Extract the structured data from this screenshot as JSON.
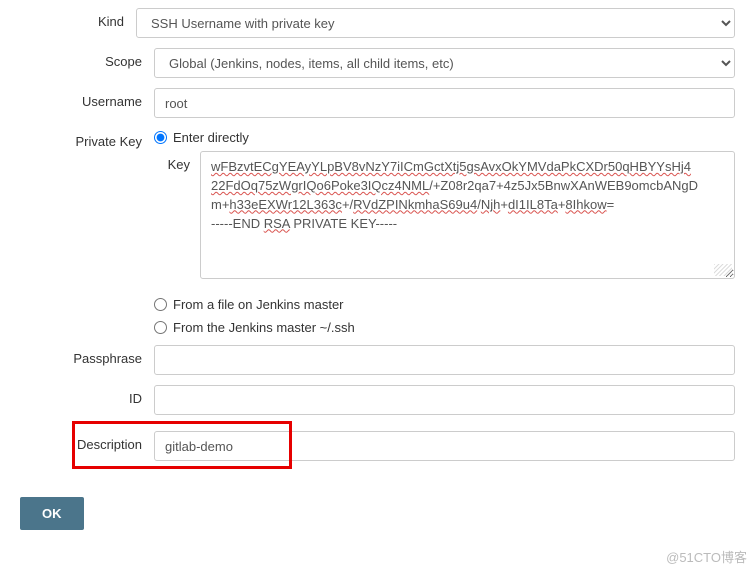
{
  "labels": {
    "kind": "Kind",
    "scope": "Scope",
    "username": "Username",
    "private_key": "Private Key",
    "key": "Key",
    "passphrase": "Passphrase",
    "id": "ID",
    "description": "Description"
  },
  "kind": {
    "selected": "SSH Username with private key"
  },
  "scope": {
    "selected": "Global (Jenkins, nodes, items, all child items, etc)"
  },
  "username": {
    "value": "root"
  },
  "private_key": {
    "options": {
      "enter_directly": "Enter directly",
      "from_file": "From a file on Jenkins master",
      "from_ssh": "From the Jenkins master ~/.ssh"
    },
    "selected": "enter_directly",
    "key_value_lines": [
      {
        "segments": [
          {
            "t": "wFBzvtECgYEAyYLpBV8vNzY7iICmGctXtj5gsAvxOkYMVdaPkCXDr50qHBYYsHj4",
            "s": true
          }
        ]
      },
      {
        "segments": [
          {
            "t": "22FdOq75zWgrIQo6Poke3IQcz4NML",
            "s": true
          },
          {
            "t": "/+Z08r2qa7+4z5Jx5BnwXAnWEB9omcbANgD",
            "s": false
          }
        ]
      },
      {
        "segments": [
          {
            "t": "m+",
            "s": false
          },
          {
            "t": "h33eEXWr12L363c",
            "s": true
          },
          {
            "t": "+/",
            "s": false
          },
          {
            "t": "RVdZPINkmhaS69u4",
            "s": true
          },
          {
            "t": "/",
            "s": false
          },
          {
            "t": "Njh",
            "s": true
          },
          {
            "t": "+",
            "s": false
          },
          {
            "t": "dI1IL8Ta",
            "s": true
          },
          {
            "t": "+",
            "s": false
          },
          {
            "t": "8Ihkow",
            "s": true
          },
          {
            "t": "=",
            "s": false
          }
        ]
      },
      {
        "segments": [
          {
            "t": "-----END ",
            "s": false
          },
          {
            "t": "RSA",
            "s": true
          },
          {
            "t": " PRIVATE KEY-----",
            "s": false
          }
        ]
      }
    ]
  },
  "passphrase": {
    "value": ""
  },
  "id": {
    "value": ""
  },
  "description": {
    "value": "gitlab-demo"
  },
  "buttons": {
    "ok": "OK"
  },
  "watermark": "@51CTO博客"
}
